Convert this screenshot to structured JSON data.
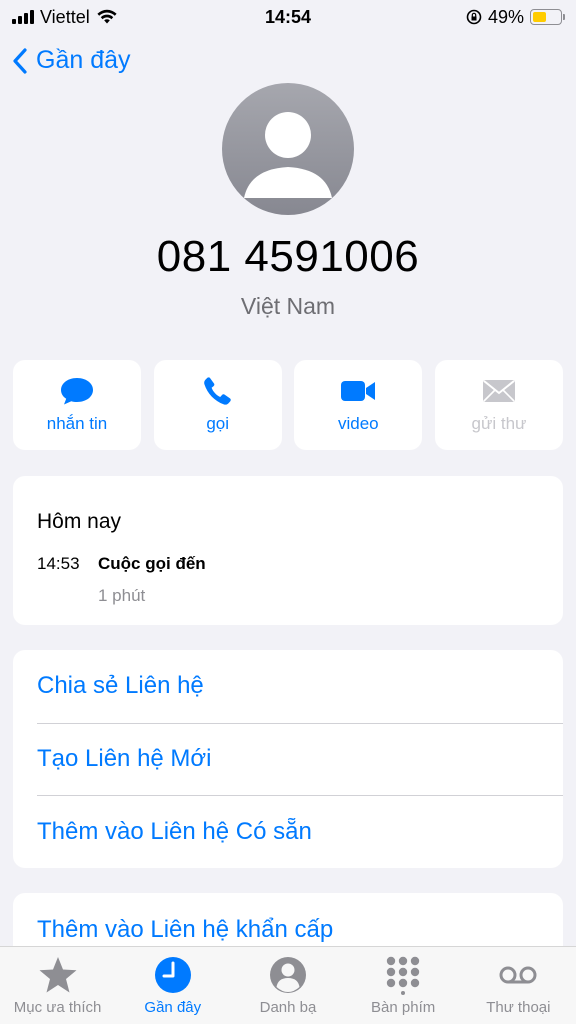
{
  "status_bar": {
    "carrier": "Viettel",
    "time": "14:54",
    "battery_percent": "49%",
    "battery_level": 0.49,
    "battery_color": "#ffcc00"
  },
  "nav": {
    "back_label": "Gần đây"
  },
  "contact": {
    "phone_number": "081 4591006",
    "country": "Việt Nam"
  },
  "actions": [
    {
      "label": "nhắn tin",
      "icon": "message-icon",
      "enabled": true
    },
    {
      "label": "gọi",
      "icon": "phone-icon",
      "enabled": true
    },
    {
      "label": "video",
      "icon": "video-icon",
      "enabled": true
    },
    {
      "label": "gửi thư",
      "icon": "mail-icon",
      "enabled": false
    }
  ],
  "recent": {
    "date_header": "Hôm nay",
    "entries": [
      {
        "time": "14:53",
        "type": "Cuộc gọi đến",
        "duration": "1 phút"
      }
    ]
  },
  "options": [
    "Chia sẻ Liên hệ",
    "Tạo Liên hệ Mới",
    "Thêm vào Liên hệ Có sẵn"
  ],
  "emergency_option": "Thêm vào Liên hệ khẩn cấp",
  "tabs": [
    {
      "label": "Mục ưa thích",
      "icon": "star-icon",
      "active": false
    },
    {
      "label": "Gần đây",
      "icon": "clock-icon",
      "active": true
    },
    {
      "label": "Danh bạ",
      "icon": "contact-icon",
      "active": false
    },
    {
      "label": "Bàn phím",
      "icon": "keypad-icon",
      "active": false
    },
    {
      "label": "Thư thoại",
      "icon": "voicemail-icon",
      "active": false
    }
  ],
  "colors": {
    "accent": "#007aff",
    "background": "#f2f2f7",
    "inactive": "#8e8e93"
  }
}
